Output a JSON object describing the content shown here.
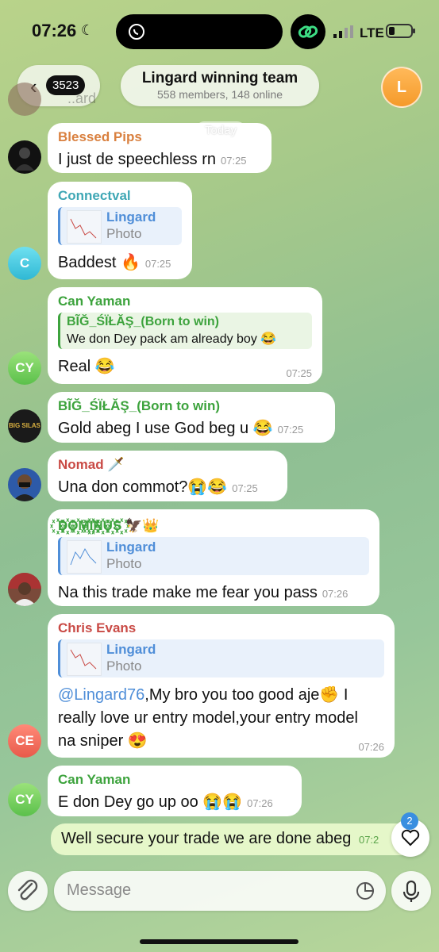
{
  "status": {
    "time": "07:26",
    "network": "LTE"
  },
  "header": {
    "back_count": "3523",
    "title": "Lingard winning team",
    "subtitle": "558 members, 148 online",
    "avatar_letter": "L"
  },
  "top_ghost": "..ard",
  "date_chip": "Today",
  "messages": [
    {
      "sender": "Blessed Pips",
      "text": "I just de speechless rn",
      "time": "07:25"
    },
    {
      "sender": "Connectval",
      "reply_name": "Lingard",
      "reply_type": "Photo",
      "text": "Baddest 🔥",
      "time": "07:25",
      "avatar_initial": "C"
    },
    {
      "sender": "Can Yaman",
      "reply_name": "BĨĞ_ŚÏŁĂŞ_(Born to win)",
      "reply_text": "We don Dey pack am already boy 😂",
      "text": "Real 😂",
      "time": "07:25",
      "avatar_initial": "CY"
    },
    {
      "sender": "BĨĞ_ŚÏŁĂŞ_(Born to win)",
      "text": "Gold abeg  I use God beg u 😂",
      "time": "07:25",
      "avatar_text": "BIG SILAS"
    },
    {
      "sender": "Nomad 🗡️",
      "text": "Una don commot?😭😂",
      "time": "07:25"
    },
    {
      "sender": "꙰D꙰O꙰M꙰I꙰N꙰U꙰S꙰ 🦅👑",
      "reply_name": "Lingard",
      "reply_type": "Photo",
      "text": "Na this trade make me fear you pass",
      "time": "07:26"
    },
    {
      "sender": "Chris Evans",
      "reply_name": "Lingard",
      "reply_type": "Photo",
      "mention": "@Lingard76",
      "text": ",My bro you too good aje✊ I really love ur entry model,your entry model na sniper 😍",
      "time": "07:26",
      "avatar_initial": "CE"
    },
    {
      "sender": "Can Yaman",
      "text": "E don Dey go up oo 😭😭",
      "time": "07:26",
      "avatar_initial": "CY"
    }
  ],
  "outgoing": {
    "text": "Well secure your trade we are done abeg",
    "time": "07:2"
  },
  "reactions": {
    "count": "2"
  },
  "composer": {
    "placeholder": "Message"
  },
  "colors": {
    "blessed": "#d9803f",
    "connectval": "#3fa7b5",
    "canyaman": "#3da33d",
    "nomad": "#c94a45",
    "dominus": "#3da33d",
    "chris": "#c94a45",
    "link": "#4f8ed8"
  }
}
